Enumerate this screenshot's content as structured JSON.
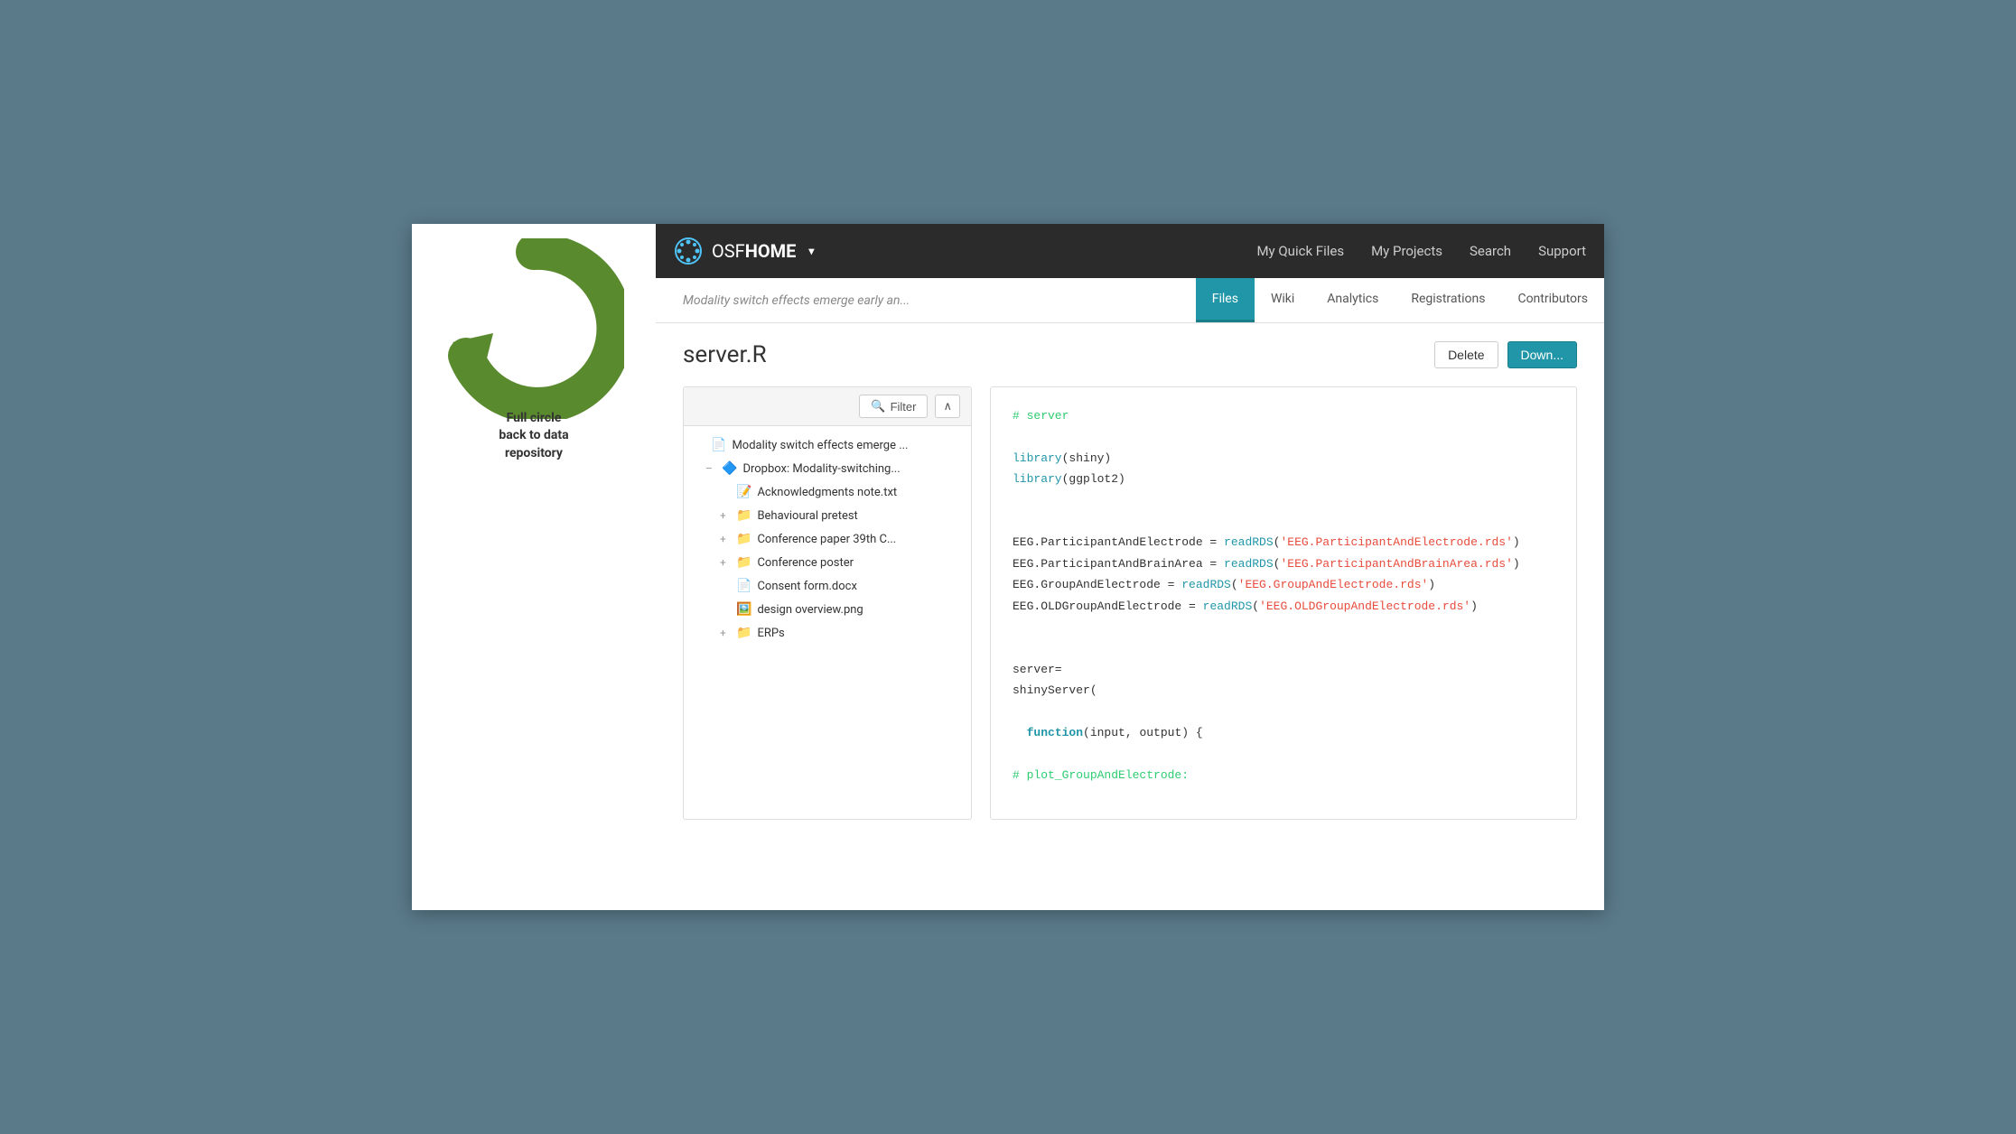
{
  "navbar": {
    "brand": "OSFHOME",
    "brand_osf": "OSF",
    "brand_home": "HOME",
    "links": [
      "My Quick Files",
      "My Projects",
      "Search",
      "Support"
    ]
  },
  "sub_navbar": {
    "title": "Modality switch effects emerge early an...",
    "tabs": [
      "Files",
      "Wiki",
      "Analytics",
      "Registrations",
      "Contributors"
    ]
  },
  "page": {
    "title": "server.R",
    "btn_delete": "Delete",
    "btn_download": "Down..."
  },
  "file_panel": {
    "filter_label": "Filter",
    "collapse_label": "∧",
    "items": [
      {
        "indent": 0,
        "icon": "📄",
        "expand": "",
        "label": "Modality switch effects emerge ..."
      },
      {
        "indent": 1,
        "icon": "🔷",
        "expand": "–",
        "label": "Dropbox: Modality-switching..."
      },
      {
        "indent": 2,
        "icon": "📝",
        "expand": "",
        "label": "Acknowledgments note.txt"
      },
      {
        "indent": 2,
        "icon": "📁",
        "expand": "+",
        "label": "Behavioural pretest"
      },
      {
        "indent": 2,
        "icon": "📁",
        "expand": "+",
        "label": "Conference paper 39th C..."
      },
      {
        "indent": 2,
        "icon": "📁",
        "expand": "+",
        "label": "Conference poster"
      },
      {
        "indent": 2,
        "icon": "📄",
        "expand": "",
        "label": "Consent form.docx"
      },
      {
        "indent": 2,
        "icon": "🖼️",
        "expand": "",
        "label": "design overview.png"
      },
      {
        "indent": 2,
        "icon": "📁",
        "expand": "+",
        "label": "ERPs"
      }
    ]
  },
  "code": {
    "lines": [
      {
        "type": "comment",
        "text": "# server"
      },
      {
        "type": "empty",
        "text": ""
      },
      {
        "type": "mixed",
        "parts": [
          {
            "t": "function",
            "v": "library"
          },
          {
            "t": "normal",
            "v": "(shiny)"
          }
        ]
      },
      {
        "type": "mixed",
        "parts": [
          {
            "t": "function",
            "v": "library"
          },
          {
            "t": "normal",
            "v": "(ggplot2)"
          }
        ]
      },
      {
        "type": "empty",
        "text": ""
      },
      {
        "type": "empty",
        "text": ""
      },
      {
        "type": "mixed",
        "parts": [
          {
            "t": "normal",
            "v": "EEG.ParticipantAndElectrode = "
          },
          {
            "t": "function",
            "v": "readRDS"
          },
          {
            "t": "normal",
            "v": "("
          },
          {
            "t": "string",
            "v": "'EEG.ParticipantAndElectrode.rds'"
          },
          {
            "t": "normal",
            "v": ")"
          }
        ]
      },
      {
        "type": "mixed",
        "parts": [
          {
            "t": "normal",
            "v": "EEG.ParticipantAndBrainArea = "
          },
          {
            "t": "function",
            "v": "readRDS"
          },
          {
            "t": "normal",
            "v": "("
          },
          {
            "t": "string",
            "v": "'EEG.ParticipantAndBrainArea.rds'"
          },
          {
            "t": "normal",
            "v": ")"
          }
        ]
      },
      {
        "type": "mixed",
        "parts": [
          {
            "t": "normal",
            "v": "EEG.GroupAndElectrode = "
          },
          {
            "t": "function",
            "v": "readRDS"
          },
          {
            "t": "normal",
            "v": "("
          },
          {
            "t": "string",
            "v": "'EEG.GroupAndElectrode.rds'"
          },
          {
            "t": "normal",
            "v": ")"
          }
        ]
      },
      {
        "type": "mixed",
        "parts": [
          {
            "t": "normal",
            "v": "EEG.OLDGroupAndElectrode = "
          },
          {
            "t": "function",
            "v": "readRDS"
          },
          {
            "t": "normal",
            "v": "("
          },
          {
            "t": "string",
            "v": "'EEG.OLDGroupAndElectrode.rds'"
          },
          {
            "t": "normal",
            "v": ")"
          }
        ]
      },
      {
        "type": "empty",
        "text": ""
      },
      {
        "type": "empty",
        "text": ""
      },
      {
        "type": "normal",
        "text": "server="
      },
      {
        "type": "normal",
        "text": "shinyServer("
      },
      {
        "type": "empty",
        "text": ""
      },
      {
        "type": "mixed",
        "parts": [
          {
            "t": "normal",
            "v": "  "
          },
          {
            "t": "keyword",
            "v": "function"
          },
          {
            "t": "normal",
            "v": "(input, output) {"
          }
        ]
      },
      {
        "type": "empty",
        "text": ""
      },
      {
        "type": "comment",
        "text": "# plot_GroupAndElectrode:"
      }
    ]
  }
}
